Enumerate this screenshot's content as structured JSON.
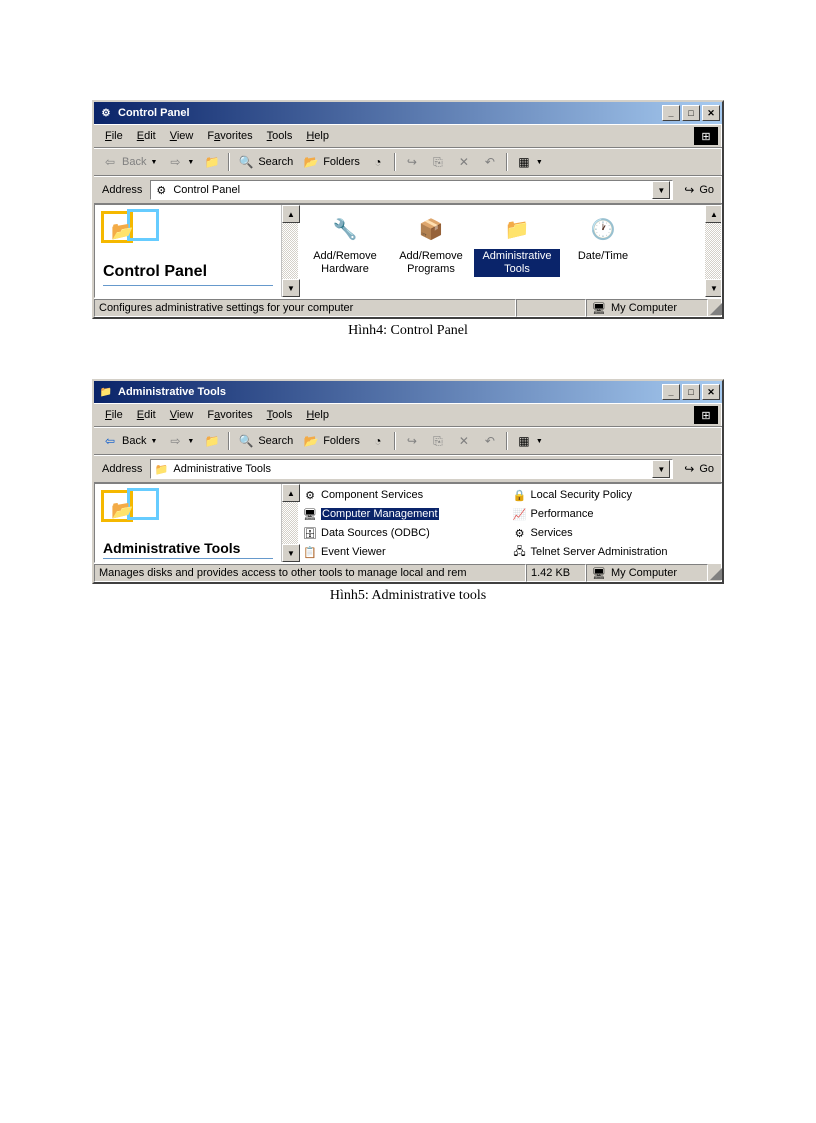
{
  "window1": {
    "title": "Control Panel",
    "menus": [
      "File",
      "Edit",
      "View",
      "Favorites",
      "Tools",
      "Help"
    ],
    "toolbar": {
      "back": "Back",
      "search": "Search",
      "folders": "Folders"
    },
    "address_label": "Address",
    "address_value": "Control Panel",
    "go_label": "Go",
    "pane_title": "Control Panel",
    "icons": [
      {
        "label": "Add/Remove Hardware",
        "selected": false
      },
      {
        "label": "Add/Remove Programs",
        "selected": false
      },
      {
        "label": "Administrative Tools",
        "selected": true
      },
      {
        "label": "Date/Time",
        "selected": false
      }
    ],
    "status_text": "Configures administrative settings for your computer",
    "status_right": "My Computer"
  },
  "window2": {
    "title": "Administrative Tools",
    "menus": [
      "File",
      "Edit",
      "View",
      "Favorites",
      "Tools",
      "Help"
    ],
    "toolbar": {
      "back": "Back",
      "search": "Search",
      "folders": "Folders"
    },
    "address_label": "Address",
    "address_value": "Administrative Tools",
    "go_label": "Go",
    "pane_title": "Administrative Tools",
    "items_col1": [
      {
        "label": "Component Services",
        "selected": false
      },
      {
        "label": "Computer Management",
        "selected": true
      },
      {
        "label": "Data Sources (ODBC)",
        "selected": false
      },
      {
        "label": "Event Viewer",
        "selected": false
      }
    ],
    "items_col2": [
      {
        "label": "Local Security Policy",
        "selected": false
      },
      {
        "label": "Performance",
        "selected": false
      },
      {
        "label": "Services",
        "selected": false
      },
      {
        "label": "Telnet Server Administration",
        "selected": false
      }
    ],
    "status_text": "Manages disks and provides access to other tools to manage local and rem",
    "status_size": "1.42 KB",
    "status_right": "My Computer"
  },
  "captions": {
    "c1": "Hình4:  Control Panel",
    "c2": "Hình5:   Administrative   tools"
  }
}
